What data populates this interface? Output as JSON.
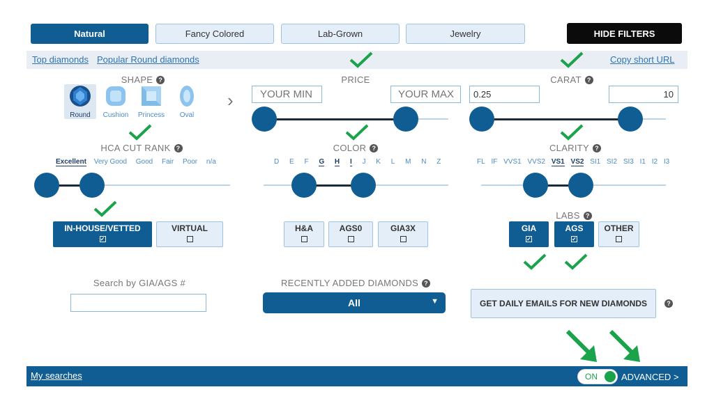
{
  "tabs": [
    {
      "label": "Natural",
      "active": true
    },
    {
      "label": "Fancy Colored",
      "active": false
    },
    {
      "label": "Lab-Grown",
      "active": false
    },
    {
      "label": "Jewelry",
      "active": false
    }
  ],
  "hide_filters_label": "HIDE FILTERS",
  "links": {
    "top_diamonds": "Top diamonds",
    "popular_round": "Popular Round diamonds",
    "copy_url": "Copy short URL"
  },
  "shape": {
    "title": "SHAPE",
    "items": [
      {
        "label": "Round",
        "icon": "round-diamond-icon",
        "selected": true
      },
      {
        "label": "Cushion",
        "icon": "cushion-diamond-icon",
        "selected": false
      },
      {
        "label": "Princess",
        "icon": "princess-diamond-icon",
        "selected": false
      },
      {
        "label": "Oval",
        "icon": "oval-diamond-icon",
        "selected": false
      }
    ],
    "more": "›"
  },
  "price": {
    "title": "PRICE",
    "min_placeholder": "YOUR MIN",
    "max_placeholder": "YOUR MAX"
  },
  "carat": {
    "title": "CARAT",
    "min": "0.25",
    "max": "10"
  },
  "cut": {
    "title": "HCA CUT RANK",
    "grades": [
      "Excellent",
      "Very Good",
      "Good",
      "Fair",
      "Poor",
      "n/a"
    ]
  },
  "color": {
    "title": "COLOR",
    "grades": [
      "D",
      "E",
      "F",
      "G",
      "H",
      "I",
      "J",
      "K",
      "L",
      "M",
      "N",
      "Z"
    ]
  },
  "clarity": {
    "title": "CLARITY",
    "grades": [
      "FL",
      "IF",
      "VVS1",
      "VVS2",
      "VS1",
      "VS2",
      "SI1",
      "SI2",
      "SI3",
      "I1",
      "I2",
      "I3"
    ]
  },
  "vendor": {
    "in_house": "IN-HOUSE/VETTED",
    "virtual": "VIRTUAL"
  },
  "performance": {
    "ha": "H&A",
    "ags0": "AGS0",
    "gia3x": "GIA3X"
  },
  "labs": {
    "title": "LABS",
    "gia": "GIA",
    "ags": "AGS",
    "other": "OTHER"
  },
  "search_cert": {
    "label": "Search by GIA/AGS #",
    "value": ""
  },
  "recent": {
    "title": "RECENTLY ADDED DIAMONDS",
    "selected": "All"
  },
  "daily_emails": "GET DAILY EMAILS FOR NEW DIAMONDS",
  "bottom": {
    "my_searches": "My searches",
    "toggle_label": "ON",
    "advanced": "ADVANCED >"
  },
  "colors": {
    "accent": "#0f5d93",
    "checkmark": "#1aa34a",
    "link": "#2f74b5"
  }
}
